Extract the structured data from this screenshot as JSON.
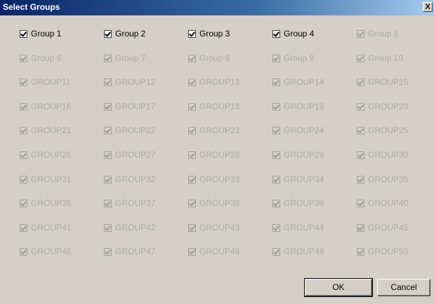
{
  "window": {
    "title": "Select Groups",
    "close_label": "X"
  },
  "groups": [
    {
      "label": "Group 1",
      "checked": true,
      "enabled": true
    },
    {
      "label": "Group 2",
      "checked": true,
      "enabled": true
    },
    {
      "label": "Group 3",
      "checked": true,
      "enabled": true
    },
    {
      "label": "Group 4",
      "checked": true,
      "enabled": true
    },
    {
      "label": "Group 5",
      "checked": true,
      "enabled": false
    },
    {
      "label": "Group 6",
      "checked": true,
      "enabled": false
    },
    {
      "label": "Group 7",
      "checked": true,
      "enabled": false
    },
    {
      "label": "Group 8",
      "checked": true,
      "enabled": false
    },
    {
      "label": "Group 9",
      "checked": true,
      "enabled": false
    },
    {
      "label": "Group 10",
      "checked": true,
      "enabled": false
    },
    {
      "label": "GROUP11",
      "checked": true,
      "enabled": false
    },
    {
      "label": "GROUP12",
      "checked": true,
      "enabled": false
    },
    {
      "label": "GROUP13",
      "checked": true,
      "enabled": false
    },
    {
      "label": "GROUP14",
      "checked": true,
      "enabled": false
    },
    {
      "label": "GROUP15",
      "checked": true,
      "enabled": false
    },
    {
      "label": "GROUP16",
      "checked": true,
      "enabled": false
    },
    {
      "label": "GROUP17",
      "checked": true,
      "enabled": false
    },
    {
      "label": "GROUP18",
      "checked": true,
      "enabled": false
    },
    {
      "label": "GROUP19",
      "checked": true,
      "enabled": false
    },
    {
      "label": "GROUP20",
      "checked": true,
      "enabled": false
    },
    {
      "label": "GROUP21",
      "checked": true,
      "enabled": false
    },
    {
      "label": "GROUP22",
      "checked": true,
      "enabled": false
    },
    {
      "label": "GROUP23",
      "checked": true,
      "enabled": false
    },
    {
      "label": "GROUP24",
      "checked": true,
      "enabled": false
    },
    {
      "label": "GROUP25",
      "checked": true,
      "enabled": false
    },
    {
      "label": "GROUP26",
      "checked": true,
      "enabled": false
    },
    {
      "label": "GROUP27",
      "checked": true,
      "enabled": false
    },
    {
      "label": "GROUP28",
      "checked": true,
      "enabled": false
    },
    {
      "label": "GROUP29",
      "checked": true,
      "enabled": false
    },
    {
      "label": "GROUP30",
      "checked": true,
      "enabled": false
    },
    {
      "label": "GROUP31",
      "checked": true,
      "enabled": false
    },
    {
      "label": "GROUP32",
      "checked": true,
      "enabled": false
    },
    {
      "label": "GROUP33",
      "checked": true,
      "enabled": false
    },
    {
      "label": "GROUP34",
      "checked": true,
      "enabled": false
    },
    {
      "label": "GROUP35",
      "checked": true,
      "enabled": false
    },
    {
      "label": "GROUP36",
      "checked": true,
      "enabled": false
    },
    {
      "label": "GROUP37",
      "checked": true,
      "enabled": false
    },
    {
      "label": "GROUP38",
      "checked": true,
      "enabled": false
    },
    {
      "label": "GROUP39",
      "checked": true,
      "enabled": false
    },
    {
      "label": "GROUP40",
      "checked": true,
      "enabled": false
    },
    {
      "label": "GROUP41",
      "checked": true,
      "enabled": false
    },
    {
      "label": "GROUP42",
      "checked": true,
      "enabled": false
    },
    {
      "label": "GROUP43",
      "checked": true,
      "enabled": false
    },
    {
      "label": "GROUP44",
      "checked": true,
      "enabled": false
    },
    {
      "label": "GROUP45",
      "checked": true,
      "enabled": false
    },
    {
      "label": "GROUP46",
      "checked": true,
      "enabled": false
    },
    {
      "label": "GROUP47",
      "checked": true,
      "enabled": false
    },
    {
      "label": "GROUP48",
      "checked": true,
      "enabled": false
    },
    {
      "label": "GROUP49",
      "checked": true,
      "enabled": false
    },
    {
      "label": "GROUP50",
      "checked": true,
      "enabled": false
    }
  ],
  "buttons": {
    "ok_label": "OK",
    "cancel_label": "Cancel"
  },
  "colors": {
    "titlebar_start": "#0a246a",
    "titlebar_end": "#a6caf0",
    "dialog_bg": "#d4d0c8",
    "disabled_text": "#a8a8a8"
  }
}
